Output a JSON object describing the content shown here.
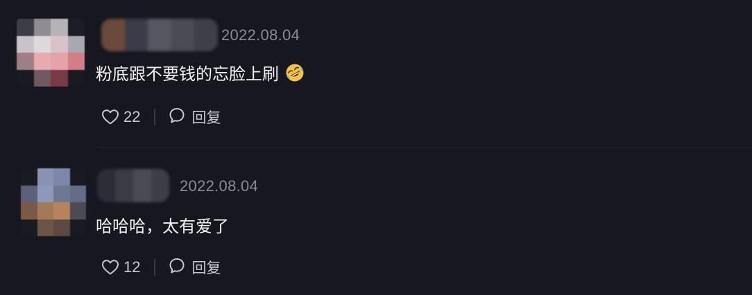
{
  "comments": [
    {
      "date": "2022.08.04",
      "text": "粉底跟不要钱的忘脸上刷",
      "emoji": "rolling-on-floor-laughing-emoji",
      "likes": "22",
      "reply_label": "回复"
    },
    {
      "date": "2022.08.04",
      "text": "哈哈哈，太有爱了",
      "likes": "12",
      "reply_label": "回复"
    }
  ],
  "colors": {
    "background": "#16171f",
    "text": "#f2f2f4",
    "muted": "#8a8b95",
    "icon": "#c8c8d0"
  },
  "icons": [
    "heart-icon",
    "comment-bubble-icon"
  ]
}
